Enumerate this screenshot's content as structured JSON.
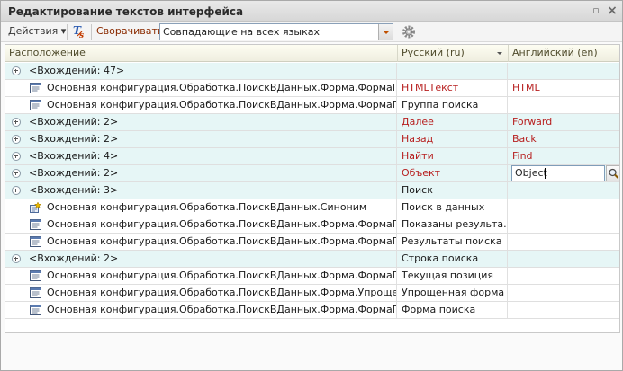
{
  "window": {
    "title": "Редактирование текстов интерфейса",
    "pin_glyph": "▫",
    "close_glyph": "×"
  },
  "toolbar": {
    "actions_label": "Действия",
    "actions_arrow": "▾",
    "translate_icon": "translate-icon",
    "collapse_label": "Сворачивать:",
    "collapse_value": "Совпадающие на всех языках",
    "settings_icon": "gear-icon"
  },
  "columns": {
    "location": "Расположение",
    "ru": "Русский (ru)",
    "en": "Английский (en)"
  },
  "rows": [
    {
      "type": "group",
      "loc": "<Вхождений: 47>",
      "ru": "",
      "en": "",
      "red": false
    },
    {
      "type": "item",
      "loc": "Основная конфигурация.Обработка.ПоискВДанных.Форма.ФормаПоис...",
      "ru": "HTMLТекст",
      "en": "HTML",
      "red": true
    },
    {
      "type": "item",
      "loc": "Основная конфигурация.Обработка.ПоискВДанных.Форма.ФормаПоис...",
      "ru": "Группа поиска",
      "en": "",
      "red": false
    },
    {
      "type": "group",
      "loc": "<Вхождений: 2>",
      "ru": "Далее",
      "en": "Forward",
      "red": true
    },
    {
      "type": "group",
      "loc": "<Вхождений: 2>",
      "ru": "Назад",
      "en": "Back",
      "red": true
    },
    {
      "type": "group",
      "loc": "<Вхождений: 4>",
      "ru": "Найти",
      "en": "Find",
      "red": true
    },
    {
      "type": "group",
      "loc": "<Вхождений: 2>",
      "ru": "Объект",
      "en": "Object",
      "red": true,
      "editing": true
    },
    {
      "type": "group",
      "loc": "<Вхождений: 3>",
      "ru": "Поиск",
      "en": "",
      "red": false
    },
    {
      "type": "item-attr",
      "loc": "Основная конфигурация.Обработка.ПоискВДанных.Синоним",
      "ru": "Поиск в данных",
      "en": "",
      "red": false
    },
    {
      "type": "item",
      "loc": "Основная конфигурация.Обработка.ПоискВДанных.Форма.ФормаПоис...",
      "ru": "Показаны результа...",
      "en": "",
      "red": false
    },
    {
      "type": "item",
      "loc": "Основная конфигурация.Обработка.ПоискВДанных.Форма.ФормаПоис...",
      "ru": "Результаты поиска",
      "en": "",
      "red": false
    },
    {
      "type": "group",
      "loc": "<Вхождений: 2>",
      "ru": "Строка поиска",
      "en": "",
      "red": false
    },
    {
      "type": "item",
      "loc": "Основная конфигурация.Обработка.ПоискВДанных.Форма.ФормаПоис...",
      "ru": "Текущая позиция",
      "en": "",
      "red": false
    },
    {
      "type": "item",
      "loc": "Основная конфигурация.Обработка.ПоискВДанных.Форма.Упрощенная...",
      "ru": "Упрощенная форма",
      "en": "",
      "red": false
    },
    {
      "type": "item",
      "loc": "Основная конфигурация.Обработка.ПоискВДанных.Форма.ФормаПоис...",
      "ru": "Форма поиска",
      "en": "",
      "red": false
    }
  ]
}
